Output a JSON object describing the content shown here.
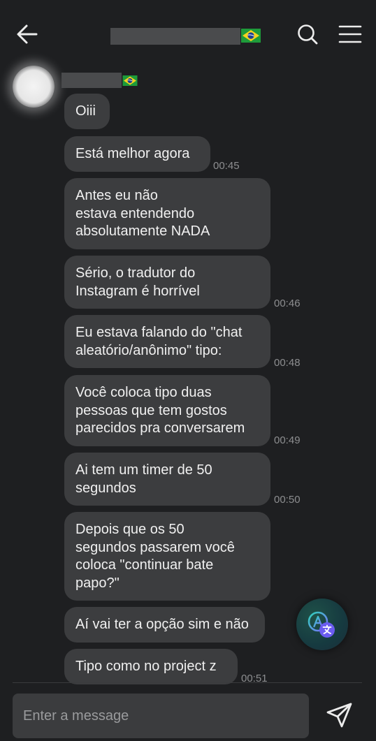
{
  "colors": {
    "background": "#1e1f21",
    "bubble": "#3c3d3f",
    "input": "#3b3c3e",
    "timestamp": "#8d8e90",
    "translate_accent": "#2fd3b8"
  },
  "header": {
    "back_icon": "arrow-left-icon",
    "flag_icon": "brazil-flag-icon",
    "search_icon": "search-icon",
    "menu_icon": "hamburger-menu-icon"
  },
  "messages": [
    {
      "text": "Oiii",
      "time": ""
    },
    {
      "text": "Está melhor agora",
      "time": "00:45"
    },
    {
      "text": "Antes eu não\nestava entendendo\nabsolutamente NADA",
      "time": ""
    },
    {
      "text": "Sério, o tradutor do\nInstagram é horrível",
      "time": "00:46"
    },
    {
      "text": "Eu estava falando do \"chat\naleatório/anônimo\" tipo:",
      "time": "00:48"
    },
    {
      "text": "Você coloca tipo duas\npessoas que tem gostos\nparecidos pra conversarem",
      "time": "00:49"
    },
    {
      "text": "Ai tem um timer de 50\nsegundos",
      "time": "00:50"
    },
    {
      "text": "Depois que os 50\nsegundos passarem você\ncoloca \"continuar bate\npapo?\"",
      "time": ""
    },
    {
      "text": "Aí vai ter a opção sim e não",
      "time": ""
    },
    {
      "text": "Tipo como no project z",
      "time": "00:51"
    }
  ],
  "composer": {
    "placeholder": "Enter a message",
    "send_icon": "send-paper-plane-icon",
    "translate_icon": "translate-icon"
  }
}
